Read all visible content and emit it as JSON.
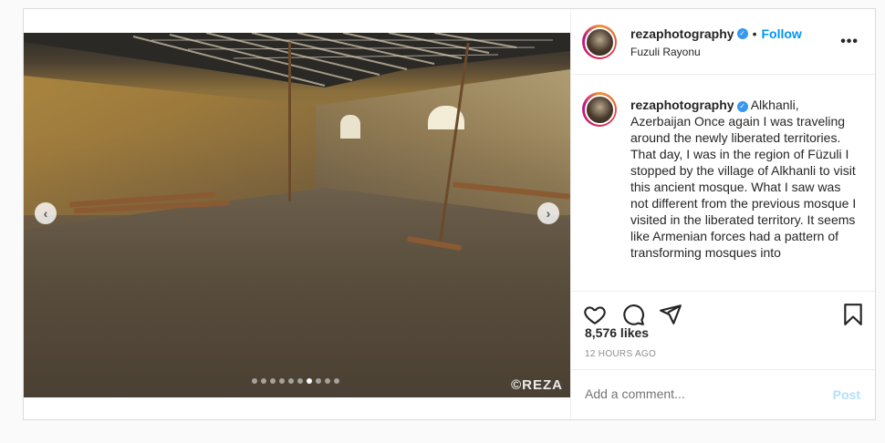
{
  "post": {
    "watermark": "©REZA",
    "carousel": {
      "total": 10,
      "active_index": 6
    }
  },
  "header": {
    "username": "rezaphotography",
    "separator": "•",
    "follow_label": "Follow",
    "location": "Fuzuli Rayonu",
    "more_label": "•••"
  },
  "caption": {
    "username": "rezaphotography",
    "location_tag": "Alkhanli, Azerbaijan",
    "text": "Once again I was traveling around the newly liberated territories. That day, I was in the region of Füzuli I stopped by the village of Alkhanli to visit this ancient mosque. What I saw was not different from the previous mosque I visited in the liberated territory. It seems like Armenian forces had a pattern of transforming mosques into"
  },
  "engagement": {
    "likes": "8,576 likes",
    "timestamp": "12 HOURS AGO"
  },
  "comment_box": {
    "placeholder": "Add a comment...",
    "post_label": "Post"
  },
  "icons": [
    "heart-icon",
    "comment-icon",
    "share-icon",
    "bookmark-icon",
    "verified-icon",
    "chevron-left-icon",
    "chevron-right-icon"
  ]
}
